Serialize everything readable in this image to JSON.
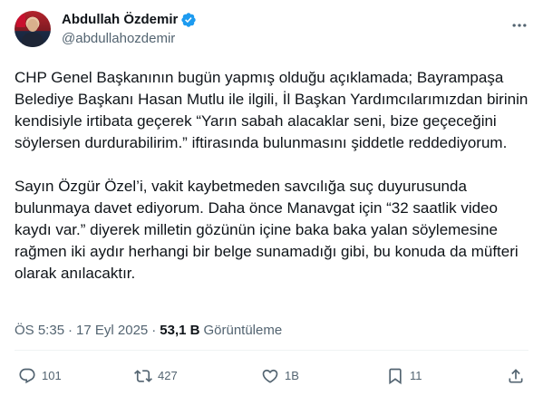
{
  "author": {
    "display_name": "Abdullah Özdemir",
    "handle": "@abdullahozdemir",
    "verified": true,
    "avatar_icon": "profile-photo"
  },
  "tweet": {
    "paragraphs": [
      "CHP Genel Başkanının bugün yapmış olduğu açıklamada; Bayrampaşa Belediye Başkanı Hasan Mutlu ile ilgili, İl Başkan Yardımcılarımızdan birinin kendisiyle irtibata geçerek “Yarın sabah alacaklar seni, bize geçeceğini söylersen durdurabilirim.” iftirasında bulunmasını şiddetle reddediyorum.",
      "Sayın Özgür Özel’i, vakit kaybetmeden savcılığa suç duyurusunda bulunmaya davet ediyorum. Daha önce Manavgat için “32 saatlik video kaydı var.” diyerek milletin gözünün içine baka baka yalan söylemesine rağmen iki aydır herhangi bir belge sunamadığı gibi, bu konuda da müfteri olarak anılacaktır."
    ]
  },
  "meta": {
    "time": "ÖS 5:35",
    "separator": "·",
    "date": "17 Eyl 2025",
    "views_count": "53,1 B",
    "views_label": "Görüntüleme"
  },
  "actions": {
    "replies": "101",
    "reposts": "427",
    "likes": "1B",
    "bookmarks": "11"
  },
  "colors": {
    "text": "#0f1419",
    "secondary": "#536471",
    "verified": "#1d9bf0",
    "divider": "#eff3f4"
  }
}
